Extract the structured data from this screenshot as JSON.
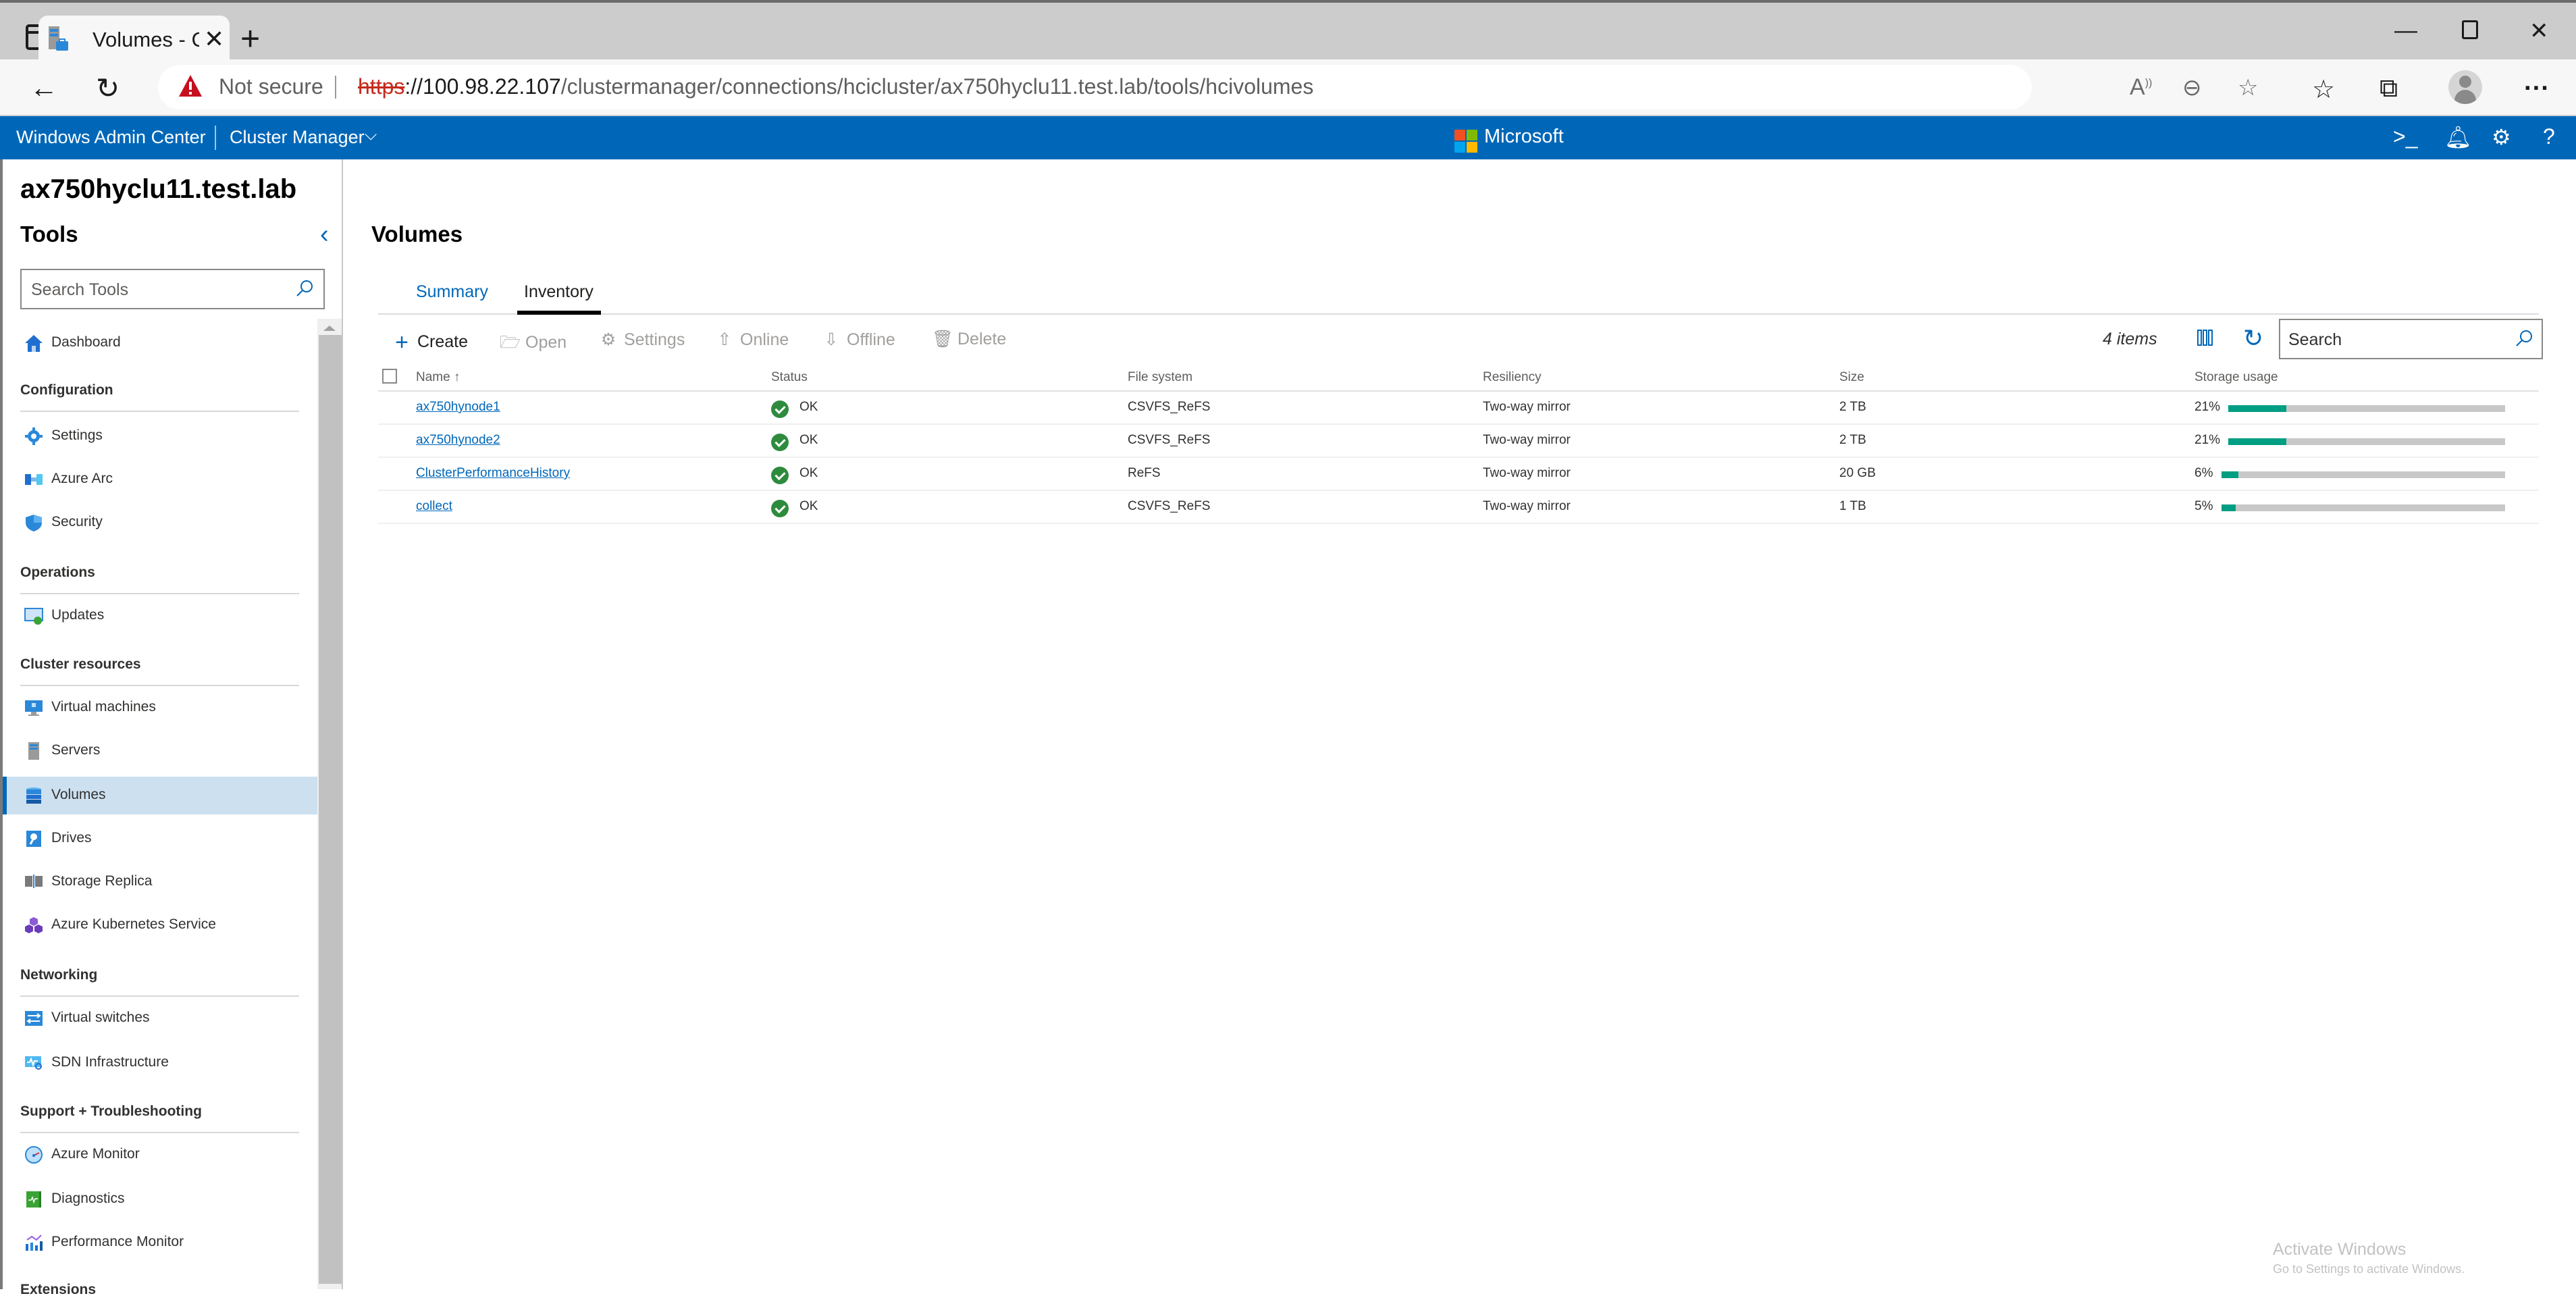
{
  "browser": {
    "tab_title": "Volumes - Cluster Manager - Windows Admin Center",
    "tab_title_visible": "Volumes - Cluster Manager - Win",
    "security_label": "Not secure",
    "url_scheme": "https",
    "url_host": "://100.98.22.107",
    "url_path": "/clustermanager/connections/hcicluster/ax750hyclu11.test.lab/tools/hcivolumes",
    "icons": {
      "tab_sidebar": "tab-actions-icon",
      "back": "back-arrow-icon",
      "refresh": "refresh-icon",
      "read_aloud": "read-aloud-icon",
      "zoom_out": "zoom-out-icon",
      "add_favorite": "add-favorite-icon",
      "favorites": "favorites-icon",
      "collections": "collections-icon",
      "profile": "profile-avatar",
      "more": "more-icon"
    }
  },
  "header": {
    "brand": "Windows Admin Center",
    "app_switcher": "Cluster Manager",
    "vendor": "Microsoft",
    "icons": [
      "powershell-icon",
      "notifications-icon",
      "settings-icon",
      "help-icon"
    ],
    "colors": {
      "bar": "#0067b8"
    }
  },
  "cluster": {
    "name": "ax750hyclu11.test.lab"
  },
  "sidebar": {
    "title": "Tools",
    "search_placeholder": "Search Tools",
    "sections": [
      {
        "label": "",
        "items": [
          {
            "label": "Dashboard",
            "icon": "home-icon"
          }
        ]
      },
      {
        "label": "Configuration",
        "items": [
          {
            "label": "Settings",
            "icon": "gear-icon"
          },
          {
            "label": "Azure Arc",
            "icon": "azure-arc-icon"
          },
          {
            "label": "Security",
            "icon": "shield-icon"
          }
        ]
      },
      {
        "label": "Operations",
        "items": [
          {
            "label": "Updates",
            "icon": "updates-icon"
          }
        ]
      },
      {
        "label": "Cluster resources",
        "items": [
          {
            "label": "Virtual machines",
            "icon": "virtual-machine-icon"
          },
          {
            "label": "Servers",
            "icon": "server-icon"
          },
          {
            "label": "Volumes",
            "icon": "volumes-icon",
            "active": true
          },
          {
            "label": "Drives",
            "icon": "drive-icon"
          },
          {
            "label": "Storage Replica",
            "icon": "storage-replica-icon"
          },
          {
            "label": "Azure Kubernetes Service",
            "icon": "kubernetes-icon"
          }
        ]
      },
      {
        "label": "Networking",
        "items": [
          {
            "label": "Virtual switches",
            "icon": "virtual-switch-icon"
          },
          {
            "label": "SDN Infrastructure",
            "icon": "sdn-icon"
          }
        ]
      },
      {
        "label": "Support + Troubleshooting",
        "items": [
          {
            "label": "Azure Monitor",
            "icon": "azure-monitor-icon"
          },
          {
            "label": "Diagnostics",
            "icon": "diagnostics-icon"
          },
          {
            "label": "Performance Monitor",
            "icon": "performance-monitor-icon"
          }
        ]
      },
      {
        "label": "Extensions",
        "items": []
      }
    ]
  },
  "main": {
    "title": "Volumes",
    "tabs": [
      {
        "label": "Summary",
        "active": false
      },
      {
        "label": "Inventory",
        "active": true
      }
    ],
    "commands": [
      {
        "label": "Create",
        "icon": "plus-icon",
        "enabled": true
      },
      {
        "label": "Open",
        "icon": "folder-open-icon",
        "enabled": false
      },
      {
        "label": "Settings",
        "icon": "gear-icon",
        "enabled": false
      },
      {
        "label": "Online",
        "icon": "arrow-up-circle-icon",
        "enabled": false
      },
      {
        "label": "Offline",
        "icon": "arrow-down-circle-icon",
        "enabled": false
      },
      {
        "label": "Delete",
        "icon": "trash-icon",
        "enabled": false
      }
    ],
    "item_count": "4 items",
    "search_placeholder": "Search",
    "columns": [
      "Name",
      "Status",
      "File system",
      "Resiliency",
      "Size",
      "Storage usage"
    ],
    "sort": {
      "column": "Name",
      "direction": "ascending"
    },
    "rows": [
      {
        "name": "ax750hynode1",
        "status": "OK",
        "file_system": "CSVFS_ReFS",
        "resiliency": "Two-way mirror",
        "size": "2 TB",
        "usage_pct": 21,
        "usage_label": "21%"
      },
      {
        "name": "ax750hynode2",
        "status": "OK",
        "file_system": "CSVFS_ReFS",
        "resiliency": "Two-way mirror",
        "size": "2 TB",
        "usage_pct": 21,
        "usage_label": "21%"
      },
      {
        "name": "ClusterPerformanceHistory",
        "status": "OK",
        "file_system": "ReFS",
        "resiliency": "Two-way mirror",
        "size": "20 GB",
        "usage_pct": 6,
        "usage_label": "6%"
      },
      {
        "name": "collect",
        "status": "OK",
        "file_system": "CSVFS_ReFS",
        "resiliency": "Two-way mirror",
        "size": "1 TB",
        "usage_pct": 5,
        "usage_label": "5%"
      }
    ],
    "colors": {
      "usage_fill": "#009e82",
      "usage_track": "#c8c8c8",
      "status_ok": "#2e8b3e",
      "link": "#0067b8"
    }
  },
  "watermark": {
    "line1": "Activate Windows",
    "line2": "Go to Settings to activate Windows."
  }
}
